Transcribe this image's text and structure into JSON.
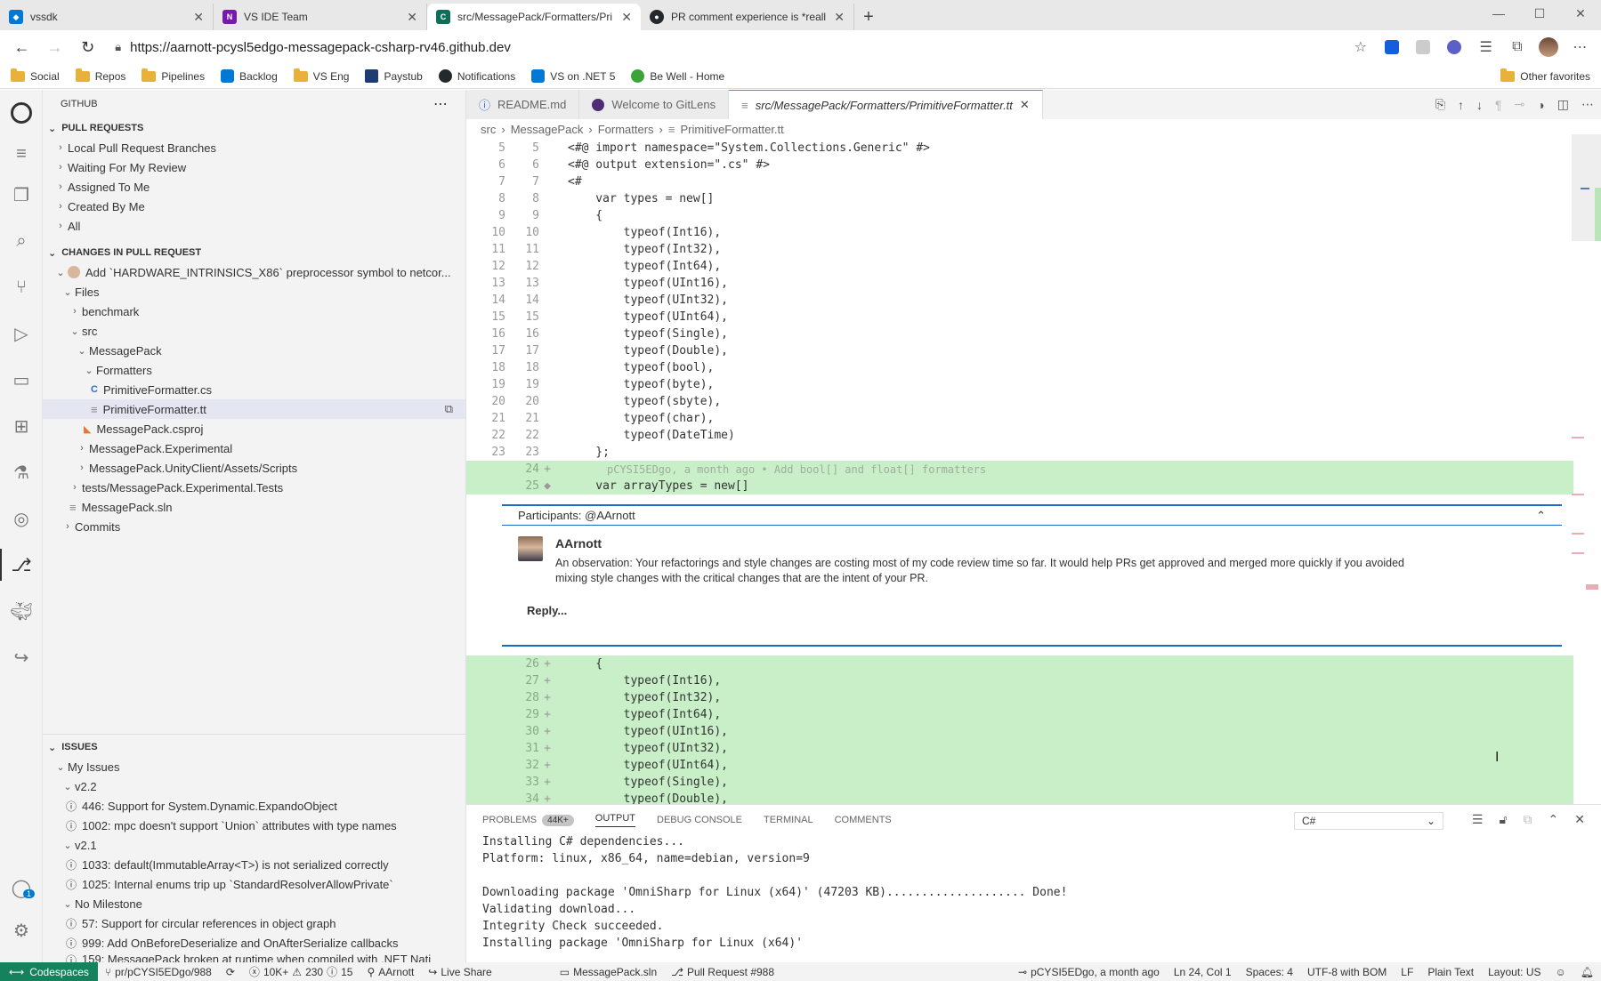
{
  "browser": {
    "tabs": [
      {
        "title": "vssdk",
        "icon": "azure-devops-icon",
        "color": "#0078d4"
      },
      {
        "title": "VS IDE Team",
        "icon": "onenote-icon",
        "color": "#7719aa"
      },
      {
        "title": "src/MessagePack/Formatters/Pri",
        "icon": "codespaces-icon",
        "color": "#0d6e5a"
      },
      {
        "title": "PR comment experience is *reall",
        "icon": "github-icon",
        "color": "#24292e"
      }
    ],
    "url": "https://aarnott-pcysl5edgo-messagepack-csharp-rv46.github.dev",
    "favorites": [
      {
        "label": "Social",
        "icon": "folder-icon"
      },
      {
        "label": "Repos",
        "icon": "folder-icon"
      },
      {
        "label": "Pipelines",
        "icon": "folder-icon"
      },
      {
        "label": "Backlog",
        "icon": "azure-devops-icon"
      },
      {
        "label": "VS Eng",
        "icon": "folder-icon"
      },
      {
        "label": "Paystub",
        "icon": "hr-icon"
      },
      {
        "label": "Notifications",
        "icon": "github-icon"
      },
      {
        "label": "VS on .NET 5",
        "icon": "azure-devops-icon"
      },
      {
        "label": "Be Well - Home",
        "icon": "leaf-icon"
      }
    ],
    "other_favorites": "Other favorites"
  },
  "sidebar": {
    "title": "GITHUB",
    "pull_requests": {
      "heading": "PULL REQUESTS",
      "items": [
        "Local Pull Request Branches",
        "Waiting For My Review",
        "Assigned To Me",
        "Created By Me",
        "All"
      ]
    },
    "changes": {
      "heading": "CHANGES IN PULL REQUEST",
      "pr_title": "Add `HARDWARE_INTRINSICS_X86` preprocessor symbol to netcor...",
      "files_label": "Files",
      "tree": {
        "benchmark": "benchmark",
        "src": "src",
        "messagepack": "MessagePack",
        "formatters": "Formatters",
        "file_cs": "PrimitiveFormatter.cs",
        "file_tt": "PrimitiveFormatter.tt",
        "csproj": "MessagePack.csproj",
        "experimental": "MessagePack.Experimental",
        "unity": "MessagePack.UnityClient/Assets/Scripts",
        "tests": "tests/MessagePack.Experimental.Tests",
        "sln": "MessagePack.sln",
        "commits": "Commits"
      }
    },
    "issues": {
      "heading": "ISSUES",
      "my_issues": "My Issues",
      "groups": [
        {
          "name": "v2.2",
          "items": [
            "446: Support for System.Dynamic.ExpandoObject",
            "1002: mpc doesn't support `Union` attributes with type names"
          ]
        },
        {
          "name": "v2.1",
          "items": [
            "1033: default(ImmutableArray<T>) is not serialized correctly",
            "1025: Internal enums trip up `StandardResolverAllowPrivate`"
          ]
        },
        {
          "name": "No Milestone",
          "items": [
            "57: Support for circular references in object graph",
            "999: Add OnBeforeDeserialize and OnAfterSerialize callbacks",
            "159: MessagePack broken at runtime when compiled with .NET Nati"
          ]
        }
      ]
    }
  },
  "editor": {
    "tabs": [
      {
        "label": "README.md",
        "icon": "info-icon"
      },
      {
        "label": "Welcome to GitLens",
        "icon": "gitlens-icon"
      },
      {
        "label": "src/MessagePack/Formatters/PrimitiveFormatter.tt",
        "icon": "file-icon"
      }
    ],
    "breadcrumb": [
      "src",
      "MessagePack",
      "Formatters",
      "PrimitiveFormatter.tt"
    ],
    "lines_top": [
      {
        "a": "5",
        "b": "5",
        "code": "<#@ import namespace=\"System.Collections.Generic\" #>"
      },
      {
        "a": "6",
        "b": "6",
        "code": "<#@ output extension=\".cs\" #>"
      },
      {
        "a": "7",
        "b": "7",
        "code": "<#"
      },
      {
        "a": "8",
        "b": "8",
        "code": "    var types = new[]"
      },
      {
        "a": "9",
        "b": "9",
        "code": "    {"
      },
      {
        "a": "10",
        "b": "10",
        "code": "        typeof(Int16),"
      },
      {
        "a": "11",
        "b": "11",
        "code": "        typeof(Int32),"
      },
      {
        "a": "12",
        "b": "12",
        "code": "        typeof(Int64),"
      },
      {
        "a": "13",
        "b": "13",
        "code": "        typeof(UInt16),"
      },
      {
        "a": "14",
        "b": "14",
        "code": "        typeof(UInt32),"
      },
      {
        "a": "15",
        "b": "15",
        "code": "        typeof(UInt64),"
      },
      {
        "a": "16",
        "b": "16",
        "code": "        typeof(Single),"
      },
      {
        "a": "17",
        "b": "17",
        "code": "        typeof(Double),"
      },
      {
        "a": "18",
        "b": "18",
        "code": "        typeof(bool),"
      },
      {
        "a": "19",
        "b": "19",
        "code": "        typeof(byte),"
      },
      {
        "a": "20",
        "b": "20",
        "code": "        typeof(sbyte),"
      },
      {
        "a": "21",
        "b": "21",
        "code": "        typeof(char),"
      },
      {
        "a": "22",
        "b": "22",
        "code": "        typeof(DateTime)"
      },
      {
        "a": "23",
        "b": "23",
        "code": "    };"
      }
    ],
    "blame": "pCYSI5EDgo, a month ago • Add bool[] and float[] formatters",
    "line24": "24",
    "line25": "25",
    "line25_code": "    var arrayTypes = new[]",
    "lines_bottom": [
      {
        "b": "26",
        "code": "    {"
      },
      {
        "b": "27",
        "code": "        typeof(Int16),"
      },
      {
        "b": "28",
        "code": "        typeof(Int32),"
      },
      {
        "b": "29",
        "code": "        typeof(Int64),"
      },
      {
        "b": "30",
        "code": "        typeof(UInt16),"
      },
      {
        "b": "31",
        "code": "        typeof(UInt32),"
      },
      {
        "b": "32",
        "code": "        typeof(UInt64),"
      },
      {
        "b": "33",
        "code": "        typeof(Single),"
      },
      {
        "b": "34",
        "code": "        typeof(Double),"
      }
    ],
    "comment": {
      "participants": "Participants: @AArnott",
      "author": "AArnott",
      "body": "An observation: Your refactorings and style changes are costing most of my code review time so far. It would help PRs get approved and merged more quickly if you avoided mixing style changes with the critical changes that are the intent of your PR.",
      "reply": "Reply..."
    }
  },
  "panel": {
    "tabs": [
      "PROBLEMS",
      "OUTPUT",
      "DEBUG CONSOLE",
      "TERMINAL",
      "COMMENTS"
    ],
    "problems_badge": "44K+",
    "active_tab": "OUTPUT",
    "channel": "C#",
    "output": [
      "Installing C# dependencies...",
      "Platform: linux, x86_64, name=debian, version=9",
      "",
      "Downloading package 'OmniSharp for Linux (x64)' (47203 KB).................... Done!",
      "Validating download...",
      "Integrity Check succeeded.",
      "Installing package 'OmniSharp for Linux (x64)'"
    ]
  },
  "status": {
    "remote": "Codespaces",
    "branch": "pr/pCYSI5EDgo/988",
    "problems": "10K+",
    "warnings": "230",
    "infos": "15",
    "user": "AArnott",
    "liveshare": "Live Share",
    "solution": "MessagePack.sln",
    "pr": "Pull Request #988",
    "blame": "pCYSI5EDgo, a month ago",
    "position": "Ln 24, Col 1",
    "spaces": "Spaces: 4",
    "encoding": "UTF-8 with BOM",
    "eol": "LF",
    "language": "Plain Text",
    "layout": "Layout: US",
    "accounts_badge": "1"
  }
}
